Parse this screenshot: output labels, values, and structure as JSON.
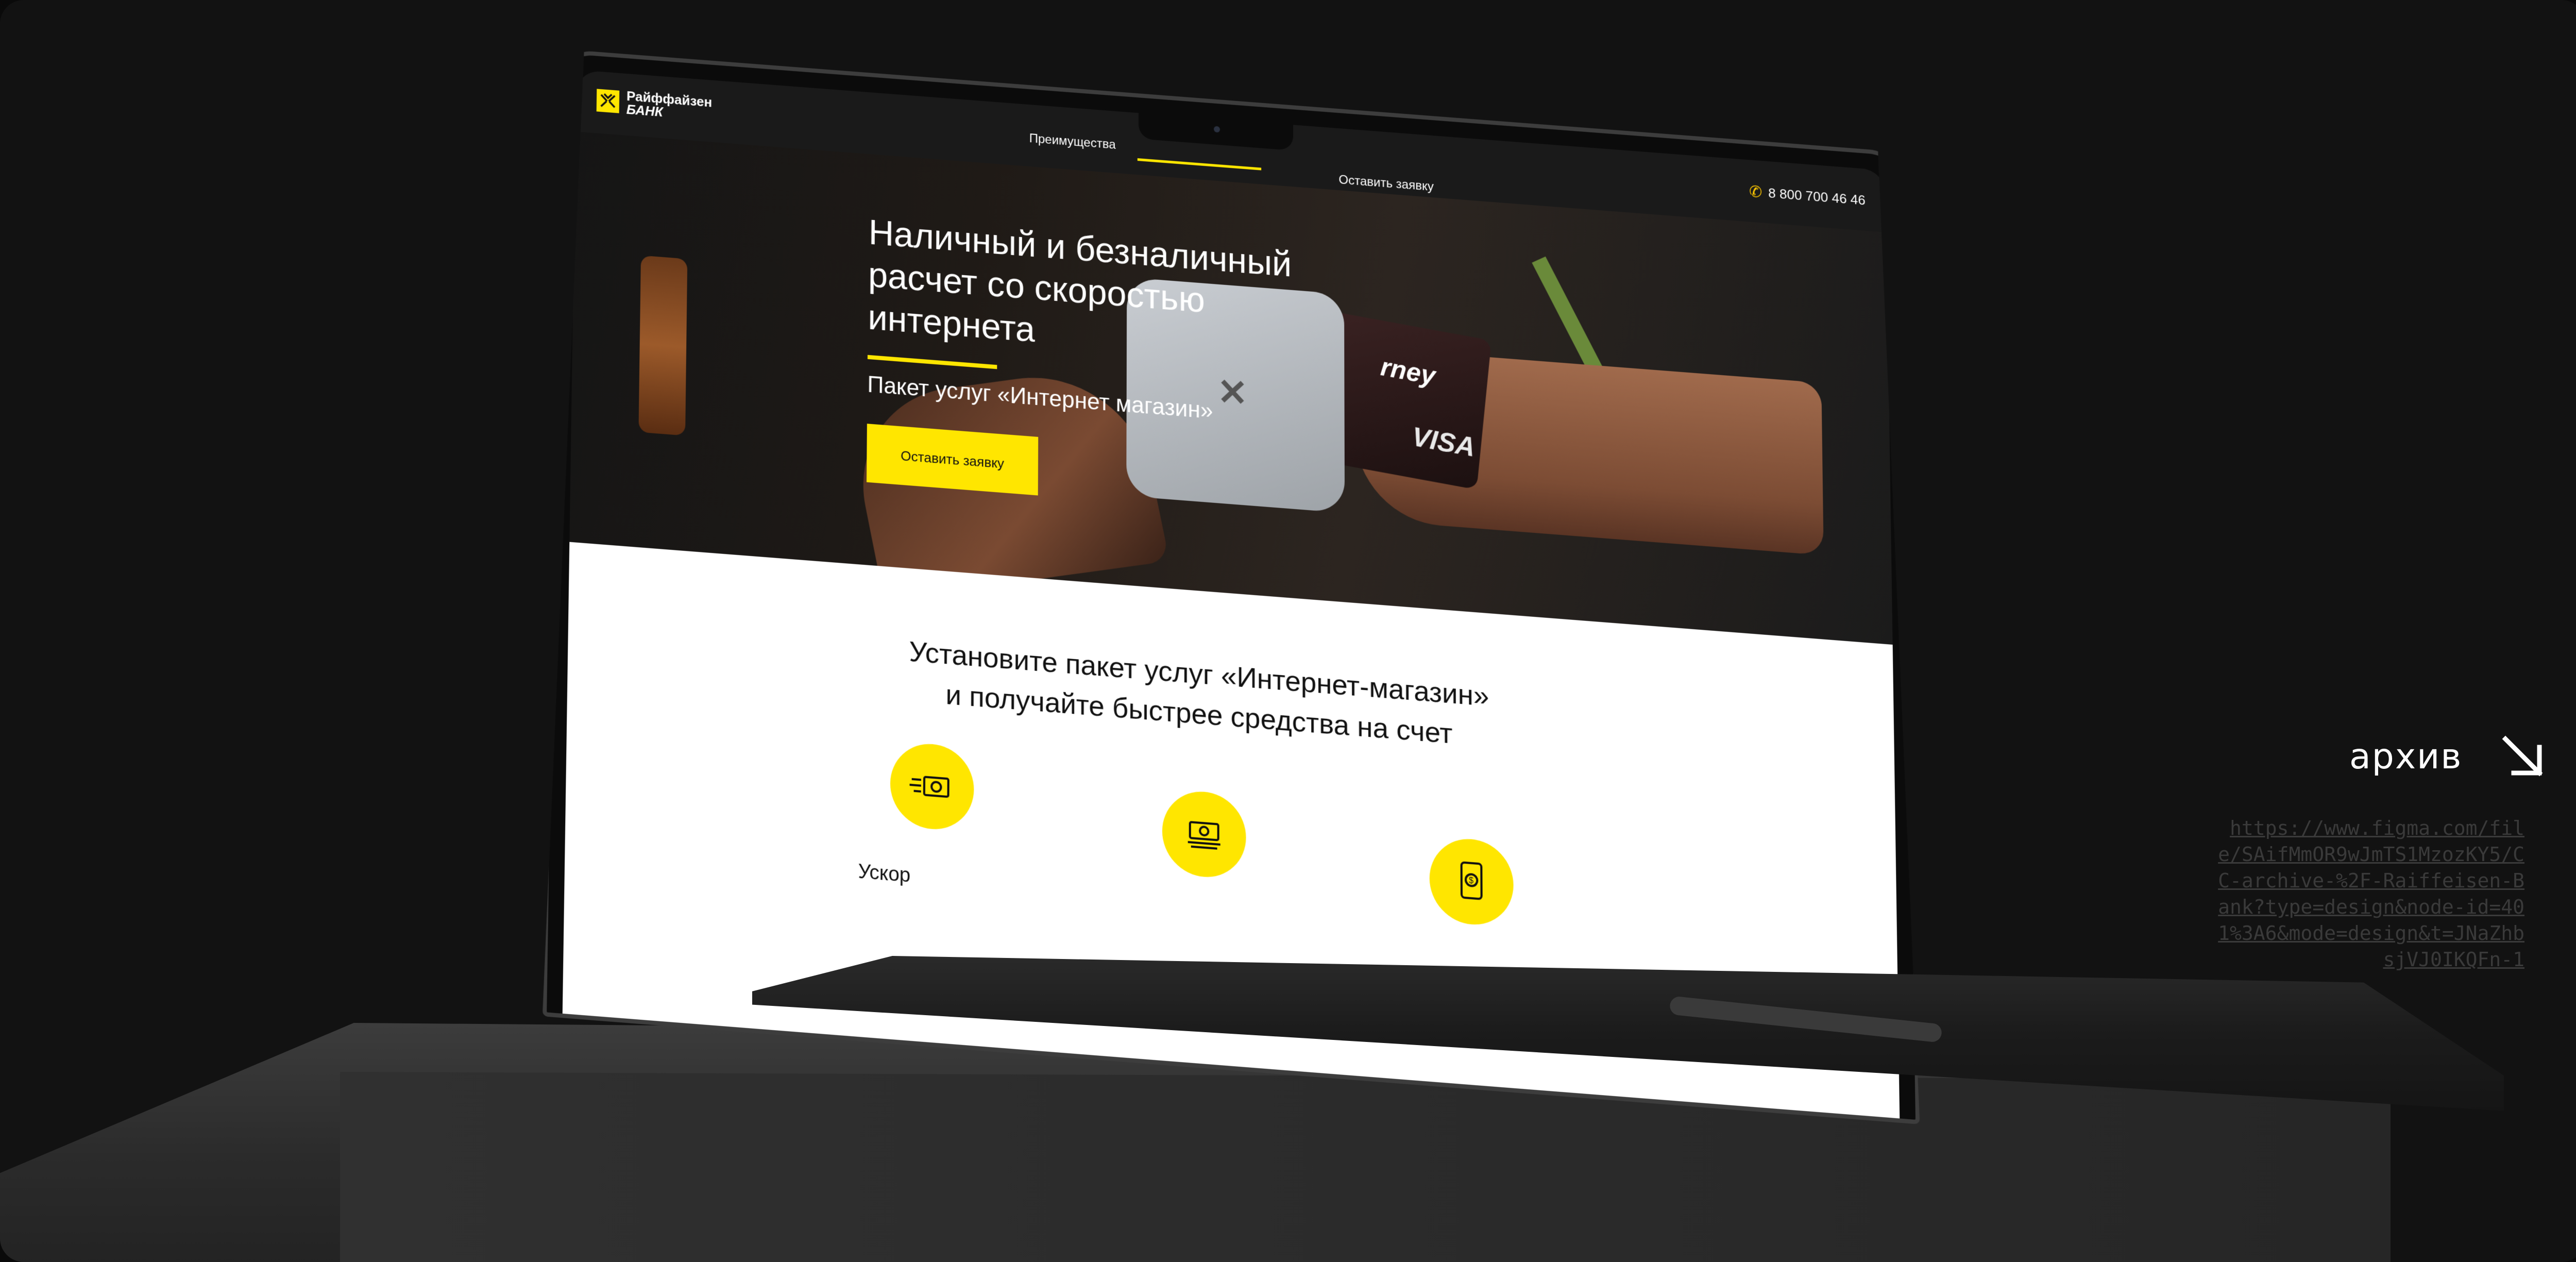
{
  "site": {
    "logo": {
      "name": "Райффайзен",
      "sub": "БАНК"
    },
    "nav": [
      {
        "label": "Преимущества"
      },
      {
        "label": ""
      },
      {
        "label": "Оставить заявку"
      }
    ],
    "phone": "8 800 700 46 46"
  },
  "hero": {
    "title": "Наличный и безналичный расчет со скоростью интернета",
    "subtitle": "Пакет услуг «Интернет магазин»",
    "cta_label": "Оставить заявку",
    "card_text": "VISA",
    "card_partial": "rney"
  },
  "features": {
    "title_line1": "Установите пакет услуг «Интернет-магазин»",
    "title_line2": "и получайте быстрее средства на счет",
    "items": [
      {
        "icon": "fast-money-icon",
        "label": "Ускор"
      },
      {
        "icon": "money-stack-icon",
        "label": ""
      },
      {
        "icon": "mobile-payment-icon",
        "label": ""
      }
    ]
  },
  "archive": {
    "label": "архив",
    "url": "https://www.figma.com/file/SAifMmOR9wJmTS1MzozKY5/CC-archive-%2F-Raiffeisen-Bank?type=design&node-id=401%3A6&mode=design&t=JNaZhbsjVJ0IKQFn-1"
  },
  "colors": {
    "accent": "#ffe600",
    "background": "#121212",
    "url_text": "#3a3a3a"
  }
}
